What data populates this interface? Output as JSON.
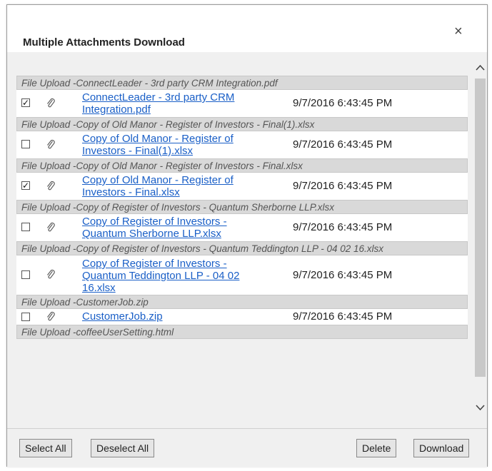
{
  "dialog": {
    "title": "Multiple Attachments Download",
    "close_label": "×"
  },
  "groups": [
    {
      "header": "File Upload -ConnectLeader - 3rd party CRM Integration.pdf",
      "file": {
        "checked": true,
        "name": "ConnectLeader - 3rd party CRM Integration.pdf",
        "date": "9/7/2016 6:43:45 PM"
      }
    },
    {
      "header": "File Upload -Copy of Old Manor - Register of Investors - Final(1).xlsx",
      "file": {
        "checked": false,
        "name": "Copy of Old Manor - Register of Investors - Final(1).xlsx",
        "date": "9/7/2016 6:43:45 PM"
      }
    },
    {
      "header": "File Upload -Copy of Old Manor - Register of Investors - Final.xlsx",
      "file": {
        "checked": true,
        "name": "Copy of Old Manor - Register of Investors - Final.xlsx",
        "date": "9/7/2016 6:43:45 PM"
      }
    },
    {
      "header": "File Upload -Copy of Register of Investors - Quantum Sherborne LLP.xlsx",
      "file": {
        "checked": false,
        "name": "Copy of Register of Investors - Quantum Sherborne LLP.xlsx",
        "date": "9/7/2016 6:43:45 PM"
      }
    },
    {
      "header": "File Upload -Copy of Register of Investors - Quantum Teddington LLP - 04 02 16.xlsx",
      "file": {
        "checked": false,
        "name": "Copy of Register of Investors - Quantum Teddington LLP - 04 02 16.xlsx",
        "date": "9/7/2016 6:43:45 PM"
      }
    },
    {
      "header": "File Upload -CustomerJob.zip",
      "file": {
        "checked": false,
        "name": "CustomerJob.zip",
        "date": "9/7/2016 6:43:45 PM"
      }
    },
    {
      "header": "File Upload -coffeeUserSetting.html"
    }
  ],
  "footer": {
    "select_all": "Select All",
    "deselect_all": "Deselect All",
    "delete": "Delete",
    "download": "Download"
  },
  "icons": {
    "close": "close-icon",
    "attachment": "paperclip-icon",
    "scroll_up": "chevron-up-icon",
    "scroll_down": "chevron-down-icon"
  },
  "colors": {
    "link": "#1a5fc7",
    "group_header_bg": "#d9d9d9",
    "panel_bg": "#f0f0f0"
  }
}
